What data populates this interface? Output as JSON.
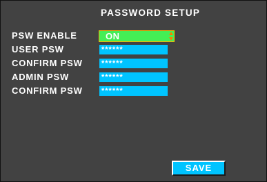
{
  "screen": {
    "title": "PASSWORD SETUP"
  },
  "form": {
    "psw_enable": {
      "label": "PSW ENABLE",
      "value": "ON"
    },
    "user_psw": {
      "label": "USER PSW",
      "value": "******"
    },
    "confirm_user_psw": {
      "label": "CONFIRM PSW",
      "value": "******"
    },
    "admin_psw": {
      "label": "ADMIN PSW",
      "value": "******"
    },
    "confirm_admin_psw": {
      "label": "CONFIRM PSW",
      "value": "******"
    }
  },
  "actions": {
    "save_label": "SAVE"
  },
  "colors": {
    "background": "#424242",
    "field": "#00c4ff",
    "toggle": "#44ee55",
    "toggle_border": "#ffb300",
    "text": "#ffffff"
  }
}
